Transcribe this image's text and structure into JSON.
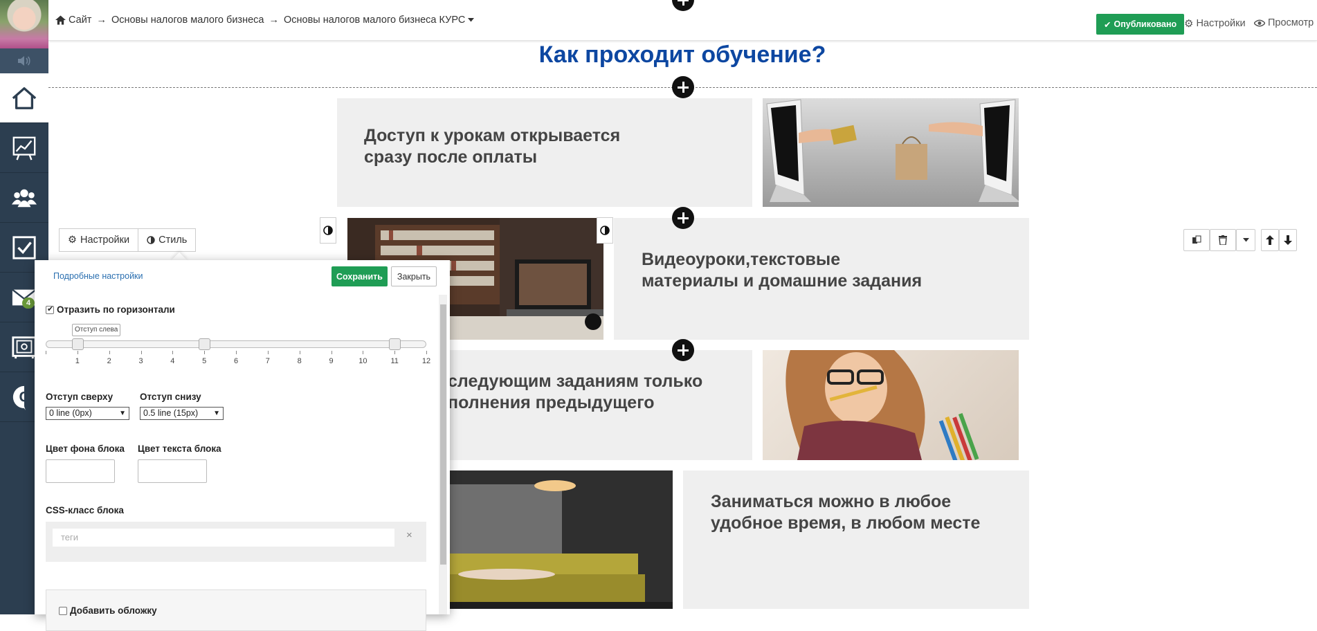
{
  "header": {
    "breadcrumb": [
      "Сайт",
      "Основы налогов малого бизнеса",
      "Основы налогов малого бизнеса КУРС"
    ],
    "breadcrumb_separator": "→",
    "publish_label": "Опубликовано",
    "settings_label": "Настройки",
    "preview_label": "Просмотр"
  },
  "sidebar": {
    "badge": "4",
    "items": [
      {
        "icon": "home-icon"
      },
      {
        "icon": "chart-icon"
      },
      {
        "icon": "users-icon"
      },
      {
        "icon": "tasks-icon"
      },
      {
        "icon": "mail-icon"
      },
      {
        "icon": "safe-icon"
      },
      {
        "icon": "chat-icon"
      }
    ]
  },
  "content": {
    "title": "Как проходит обучение?",
    "blocks": [
      {
        "text": "Доступ к урокам открывается сразу после оплаты"
      },
      {
        "text": "Видеоуроки,текстовые материалы и домашние задания"
      },
      {
        "text": "следующим заданиям только\nполнения предыдущего"
      },
      {
        "text": "Заниматься можно в любое удобное время, в любом месте"
      }
    ]
  },
  "panel": {
    "tabs": {
      "settings": "Настройки",
      "style": "Стиль"
    },
    "detail_link": "Подробные настройки",
    "save": "Сохранить",
    "close": "Закрыть",
    "mirror_label": "Отразить по горизонтали",
    "mirror_checked": true,
    "slider_tooltip": "Отступ слева",
    "slider_ticks": [
      "1",
      "2",
      "3",
      "4",
      "5",
      "6",
      "7",
      "8",
      "9",
      "10",
      "11",
      "12"
    ],
    "slider_values": [
      1,
      5,
      11
    ],
    "padding_top_label": "Отступ сверху",
    "padding_top_value": "0 line (0px)",
    "padding_bottom_label": "Отступ снизу",
    "padding_bottom_value": "0.5 line (15px)",
    "bg_color_label": "Цвет фона блока",
    "text_color_label": "Цвет текста блока",
    "css_label": "CSS-класс блока",
    "tags_placeholder": "теги",
    "tags_clear": "×",
    "cover_label": "Добавить обложку",
    "cover_checked": false
  },
  "colors": {
    "sidebar": "#2c3e50",
    "accent_green": "#1f9d55",
    "title_blue": "#0d47a1"
  }
}
